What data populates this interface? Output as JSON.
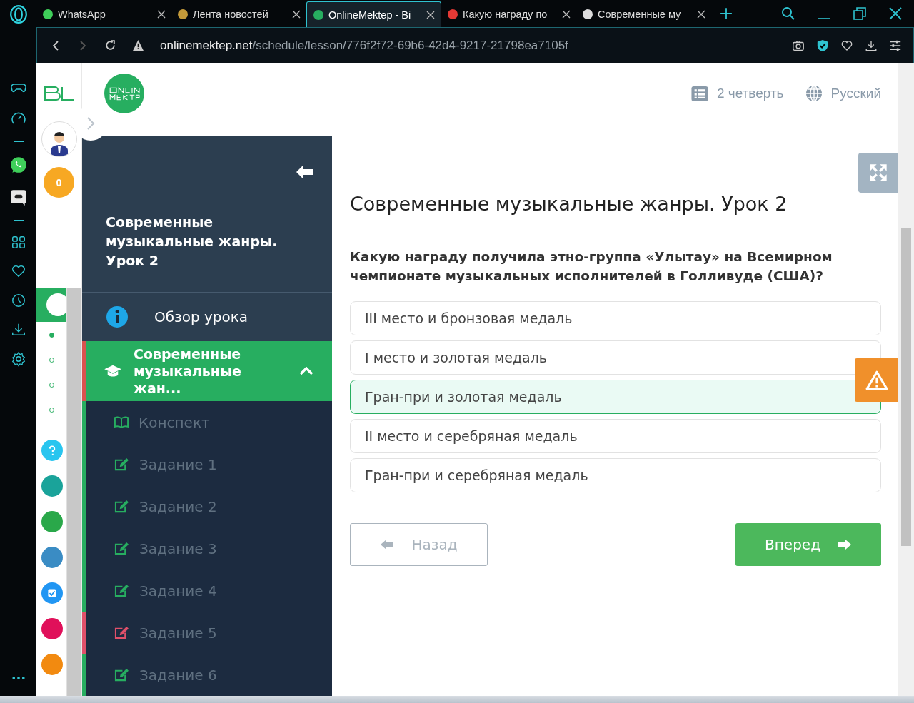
{
  "browser": {
    "tabs": [
      {
        "title": "WhatsApp",
        "selected": false
      },
      {
        "title": "Лента новостей",
        "selected": false
      },
      {
        "title": "OnlineMektep - Bi",
        "selected": true
      },
      {
        "title": "Какую награду по",
        "selected": false
      },
      {
        "title": "Современные му",
        "selected": false
      }
    ],
    "url_host": "onlinemektep.net",
    "url_path": "/schedule/lesson/776f2f72-69b6-42d4-9217-21798ea7105f"
  },
  "side_panel": {
    "coins": "0",
    "steps": [
      {
        "selected": true
      },
      {
        "selected": false
      },
      {
        "selected": false
      },
      {
        "selected": false
      }
    ]
  },
  "header": {
    "quarter": "2 четверть",
    "language": "Русский"
  },
  "lesson_nav": {
    "title": "Современные музыкальные жанры. Урок 2",
    "overview": "Обзор урока",
    "section": {
      "label": "Современные музыкальные жан...",
      "expanded": true,
      "color": "#d9534f"
    },
    "items": [
      {
        "label": "Конспект",
        "kind": "notes",
        "color": "#27ae60"
      },
      {
        "label": "Задание 1",
        "kind": "task",
        "color": "#27ae60"
      },
      {
        "label": "Задание 2",
        "kind": "task",
        "color": "#27ae60"
      },
      {
        "label": "Задание 3",
        "kind": "task",
        "color": "#27ae60"
      },
      {
        "label": "Задание 4",
        "kind": "task",
        "color": "#27ae60"
      },
      {
        "label": "Задание 5",
        "kind": "task",
        "color": "#e0506a"
      },
      {
        "label": "Задание 6",
        "kind": "task",
        "color": "#27ae60"
      }
    ]
  },
  "lesson": {
    "title": "Современные музыкальные жанры. Урок 2",
    "question": "Какую награду получила этно-группа «Улытау» на Всемирном чемпионате музыкальных исполнителей в Голливуде (США)?",
    "answers": [
      {
        "text": "III место и бронзовая медаль",
        "selected": false
      },
      {
        "text": "I место и золотая медаль",
        "selected": false
      },
      {
        "text": "Гран-при и золотая медаль",
        "selected": true
      },
      {
        "text": "II место и серебряная медаль",
        "selected": false
      },
      {
        "text": "Гран-при и серебряная медаль",
        "selected": false
      }
    ],
    "back_button": "Назад",
    "next_button": "Вперед"
  }
}
